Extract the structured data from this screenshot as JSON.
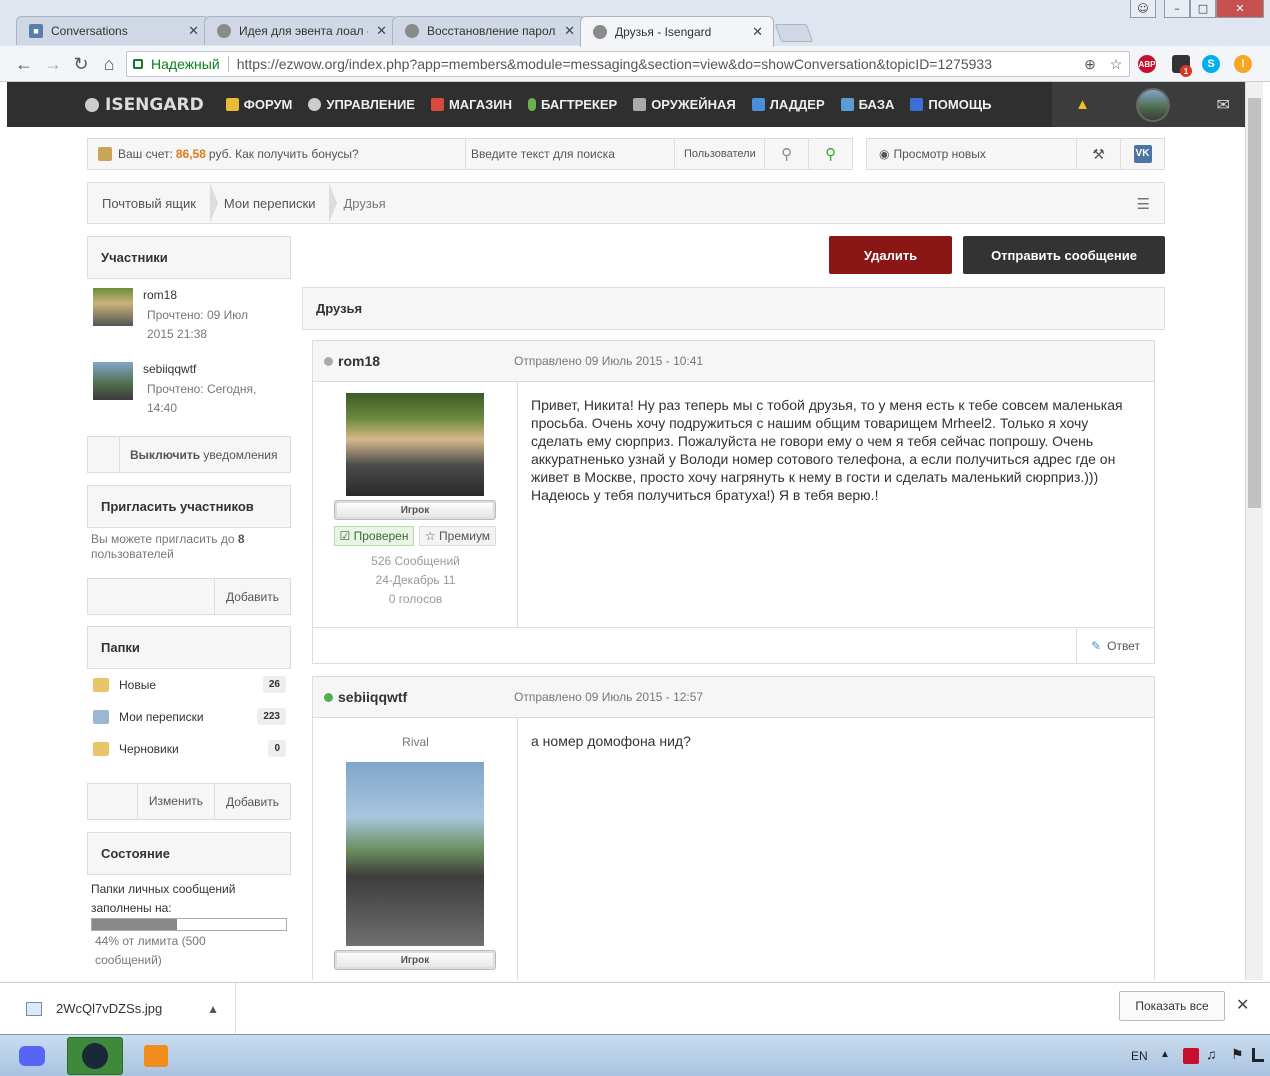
{
  "browser": {
    "tabs": [
      {
        "title": "Conversations",
        "active": false
      },
      {
        "title": "Идея для эвента лоал -",
        "active": false
      },
      {
        "title": "Восстановление пароля",
        "active": false
      },
      {
        "title": "Друзья - Isengard",
        "active": true
      }
    ],
    "secure_label": "Надежный",
    "url": "https://ezwow.org/index.php?app=members&module=messaging&section=view&do=showConversation&topicID=1275933",
    "ext_badge": "1",
    "abp_label": "ABP"
  },
  "site_nav": {
    "logo": "ISENGARD",
    "items": [
      {
        "label": "ФОРУМ",
        "icon": "forum-icon",
        "color": "#e8b93a"
      },
      {
        "label": "УПРАВЛЕНИЕ",
        "icon": "gear-icon",
        "color": "#cccccc"
      },
      {
        "label": "МАГАЗИН",
        "icon": "shop-icon",
        "color": "#d94a3a"
      },
      {
        "label": "БАГТРЕКЕР",
        "icon": "bug-icon",
        "color": "#6ab04c"
      },
      {
        "label": "ОРУЖЕЙНАЯ",
        "icon": "armory-icon",
        "color": "#aaaaaa"
      },
      {
        "label": "ЛАДДЕР",
        "icon": "ladder-icon",
        "color": "#4a90d9"
      },
      {
        "label": "БАЗА",
        "icon": "book-icon",
        "color": "#5b9bd5"
      },
      {
        "label": "ПОМОЩЬ",
        "icon": "info-icon",
        "color": "#3a6fd8"
      }
    ]
  },
  "userbar": {
    "balance_prefix": "Ваш счет:",
    "balance": "86,58",
    "balance_suffix": "руб. Как получить бонусы?",
    "search_placeholder": "Введите текст для поиска",
    "search_scope": "Пользователи",
    "view_new": "Просмотр новых"
  },
  "breadcrumb": [
    "Почтовый ящик",
    "Мои переписки",
    "Друзья"
  ],
  "sidebar": {
    "participants_title": "Участники",
    "participants": [
      {
        "name": "rom18",
        "read_label": "Прочтено: 09 Июл 2015 21:38"
      },
      {
        "name": "sebiiqqwtf",
        "read_label": "Прочтено: Сегодня, 14:40"
      }
    ],
    "notify_button": "Выключить",
    "notify_button_suffix": "уведомления",
    "invite_title": "Пригласить участников",
    "invite_text": "Вы можете пригласить до",
    "invite_count": "8",
    "invite_text_suffix": "пользователей",
    "add_label": "Добавить",
    "folders_title": "Папки",
    "folders": [
      {
        "name": "Новые",
        "count": "26"
      },
      {
        "name": "Мои переписки",
        "count": "223"
      },
      {
        "name": "Черновики",
        "count": "0"
      }
    ],
    "edit_label": "Изменить",
    "add_label2": "Добавить",
    "status_title": "Состояние",
    "status_text": "Папки личных сообщений заполнены на:",
    "status_percent_value": 0.44,
    "status_percent": "44% от лимита (500 сообщений)"
  },
  "actions": {
    "delete": "Удалить",
    "send": "Отправить сообщение"
  },
  "thread_title": "Друзья",
  "posts": [
    {
      "author": "rom18",
      "online": false,
      "date": "Отправлено 09 Июль 2015 - 10:41",
      "rank": "Игрок",
      "badge_verified": "Проверен",
      "badge_premium": "Премиум",
      "stat_posts": "526 Сообщений",
      "stat_joined": "24-Декабрь 11",
      "stat_votes": "0 голосов",
      "body": "Привет, Никита! Ну раз теперь мы с тобой друзья, то у меня есть к тебе совсем маленькая просьба. Очень хочу подружиться с нашим общим товарищем Mrheel2. Только я хочу сделать ему сюрприз. Пожалуйста не говори ему о чем я тебя сейчас попрошу. Очень аккуратненько узнай у Володи номер сотового телефона, а если получиться адрес где он живет в Москве, просто хочу нагрянуть к нему в гости и сделать маленький сюрприз.))) Надеюсь у тебя получиться братуха!) Я в тебя верю.!",
      "reply": "Ответ"
    },
    {
      "author": "sebiiqqwtf",
      "online": true,
      "date": "Отправлено 09 Июль 2015 - 12:57",
      "title": "Rival",
      "rank": "Игрок",
      "body": "а номер домофона нид?"
    }
  ],
  "download_bar": {
    "file": "2WcQl7vDZSs.jpg",
    "show_all": "Показать все"
  },
  "taskbar": {
    "lang": "EN"
  }
}
